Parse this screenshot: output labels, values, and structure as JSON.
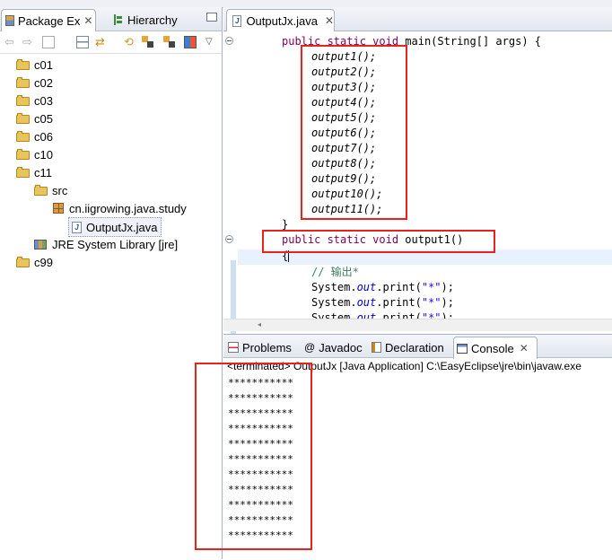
{
  "left_panel": {
    "tabs": [
      {
        "label": "Package Ex",
        "close": "✕"
      },
      {
        "label": "Hierarchy"
      }
    ],
    "tree": [
      {
        "label": "c01",
        "icon": "project-folder-icon"
      },
      {
        "label": "c02",
        "icon": "project-folder-icon"
      },
      {
        "label": "c03",
        "icon": "project-folder-icon"
      },
      {
        "label": "c05",
        "icon": "project-folder-icon"
      },
      {
        "label": "c06",
        "icon": "project-folder-icon"
      },
      {
        "label": "c10",
        "icon": "project-folder-icon"
      },
      {
        "label": "c11",
        "icon": "project-folder-icon"
      },
      {
        "label": "src",
        "icon": "source-folder-icon"
      },
      {
        "label": "cn.iigrowing.java.study",
        "icon": "package-icon"
      },
      {
        "label": "OutputJx.java",
        "icon": "java-file-icon"
      },
      {
        "label": "JRE System Library [jre]",
        "icon": "library-icon"
      },
      {
        "label": "c99",
        "icon": "project-folder-icon"
      }
    ]
  },
  "editor": {
    "tab": {
      "label": "OutputJx.java",
      "close": "✕"
    },
    "code": {
      "main_kw": "public static void",
      "main_sig": " main(String[] args) {",
      "calls": [
        "output1();",
        "output2();",
        "output3();",
        "output4();",
        "output5();",
        "output6();",
        "output7();",
        "output8();",
        "output9();",
        "output10();",
        "output11();"
      ],
      "close_brace": "}",
      "method_kw": "public static void",
      "method_name": " output1()",
      "open_brace": "{",
      "comment": "// 输出*",
      "print_prefix": "System.",
      "print_field": "out",
      "print_method": ".print(",
      "print_arg": "\"*\"",
      "print_suffix": ");"
    }
  },
  "console": {
    "tabs": [
      {
        "label": "Problems",
        "icon": "problems-icon"
      },
      {
        "label": "Javadoc",
        "icon": "at-icon"
      },
      {
        "label": "Declaration",
        "icon": "declaration-icon"
      },
      {
        "label": "Console",
        "icon": "console-icon",
        "close": "✕"
      }
    ],
    "status": "<terminated> OutputJx [Java Application] C:\\EasyEclipse\\jre\\bin\\javaw.exe",
    "output": [
      "***********",
      "***********",
      "***********",
      "***********",
      "***********",
      "***********",
      "***********",
      "***********",
      "***********",
      "***********",
      "***********"
    ]
  },
  "colors": {
    "highlight_red": "#e8231d",
    "keyword": "#7f0055",
    "string": "#2a00ff",
    "comment": "#3f7f5f",
    "field": "#0000c0"
  }
}
